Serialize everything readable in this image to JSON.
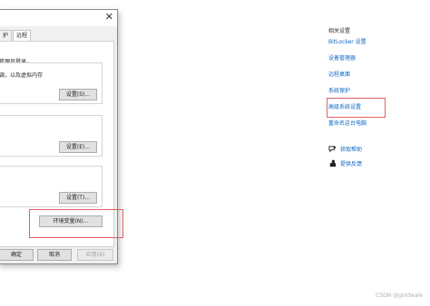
{
  "dialog": {
    "close_glyph": "✕",
    "tabs": [
      "护",
      "远程"
    ],
    "admin_note": "管理员登录。",
    "performance_text": "调，以及虚拟内存",
    "performance_button": "设置(S)...",
    "profiles_button": "设置(E)...",
    "startup_button": "设置(T)...",
    "env_button": "环境变量(N)...",
    "ok_button": "确定",
    "cancel_button": "取消",
    "apply_button": "应用(A)"
  },
  "related": {
    "heading": "相关设置",
    "links": [
      "BitLocker 设置",
      "设备管理器",
      "远程桌面",
      "系统保护",
      "高级系统设置",
      "重命名这台电脑"
    ]
  },
  "help": {
    "get_help": "获取帮助",
    "feedback": "提供反馈"
  },
  "watermark": "CSDN @goldwale",
  "colors": {
    "highlight": "#e06060",
    "link": "#0b66c2"
  }
}
